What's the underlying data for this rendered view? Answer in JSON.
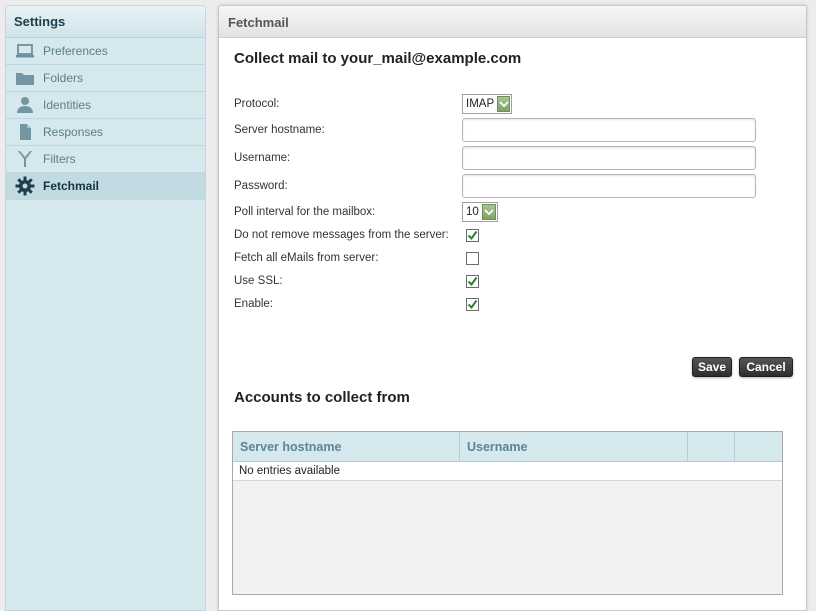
{
  "sidebar": {
    "title": "Settings",
    "items": [
      {
        "label": "Preferences",
        "icon": "laptop-icon"
      },
      {
        "label": "Folders",
        "icon": "folder-icon"
      },
      {
        "label": "Identities",
        "icon": "person-icon"
      },
      {
        "label": "Responses",
        "icon": "document-icon"
      },
      {
        "label": "Filters",
        "icon": "filter-icon"
      },
      {
        "label": "Fetchmail",
        "icon": "gear-icon",
        "active": true
      }
    ]
  },
  "main": {
    "header": "Fetchmail",
    "collect_title": "Collect mail to your_mail@example.com",
    "form": {
      "protocol_label": "Protocol:",
      "protocol_value": "IMAP",
      "hostname_label": "Server hostname:",
      "hostname_value": "",
      "username_label": "Username:",
      "username_value": "",
      "password_label": "Password:",
      "password_value": "",
      "poll_label": "Poll interval for the mailbox:",
      "poll_value": "10",
      "keep_label": "Do not remove messages from the server:",
      "keep_checked": true,
      "fetchall_label": "Fetch all eMails from server:",
      "fetchall_checked": false,
      "ssl_label": "Use SSL:",
      "ssl_checked": true,
      "enable_label": "Enable:",
      "enable_checked": true
    },
    "buttons": {
      "save": "Save",
      "cancel": "Cancel"
    },
    "accounts_title": "Accounts to collect from",
    "table": {
      "columns": [
        "Server hostname",
        "Username",
        "",
        ""
      ],
      "empty_text": "No entries available"
    }
  },
  "colors": {
    "sidebar_bg": "#d5e8ee",
    "active_item": "#c2dbe3",
    "checkbox_check": "#2e7d32",
    "button_dark": "#333333"
  }
}
